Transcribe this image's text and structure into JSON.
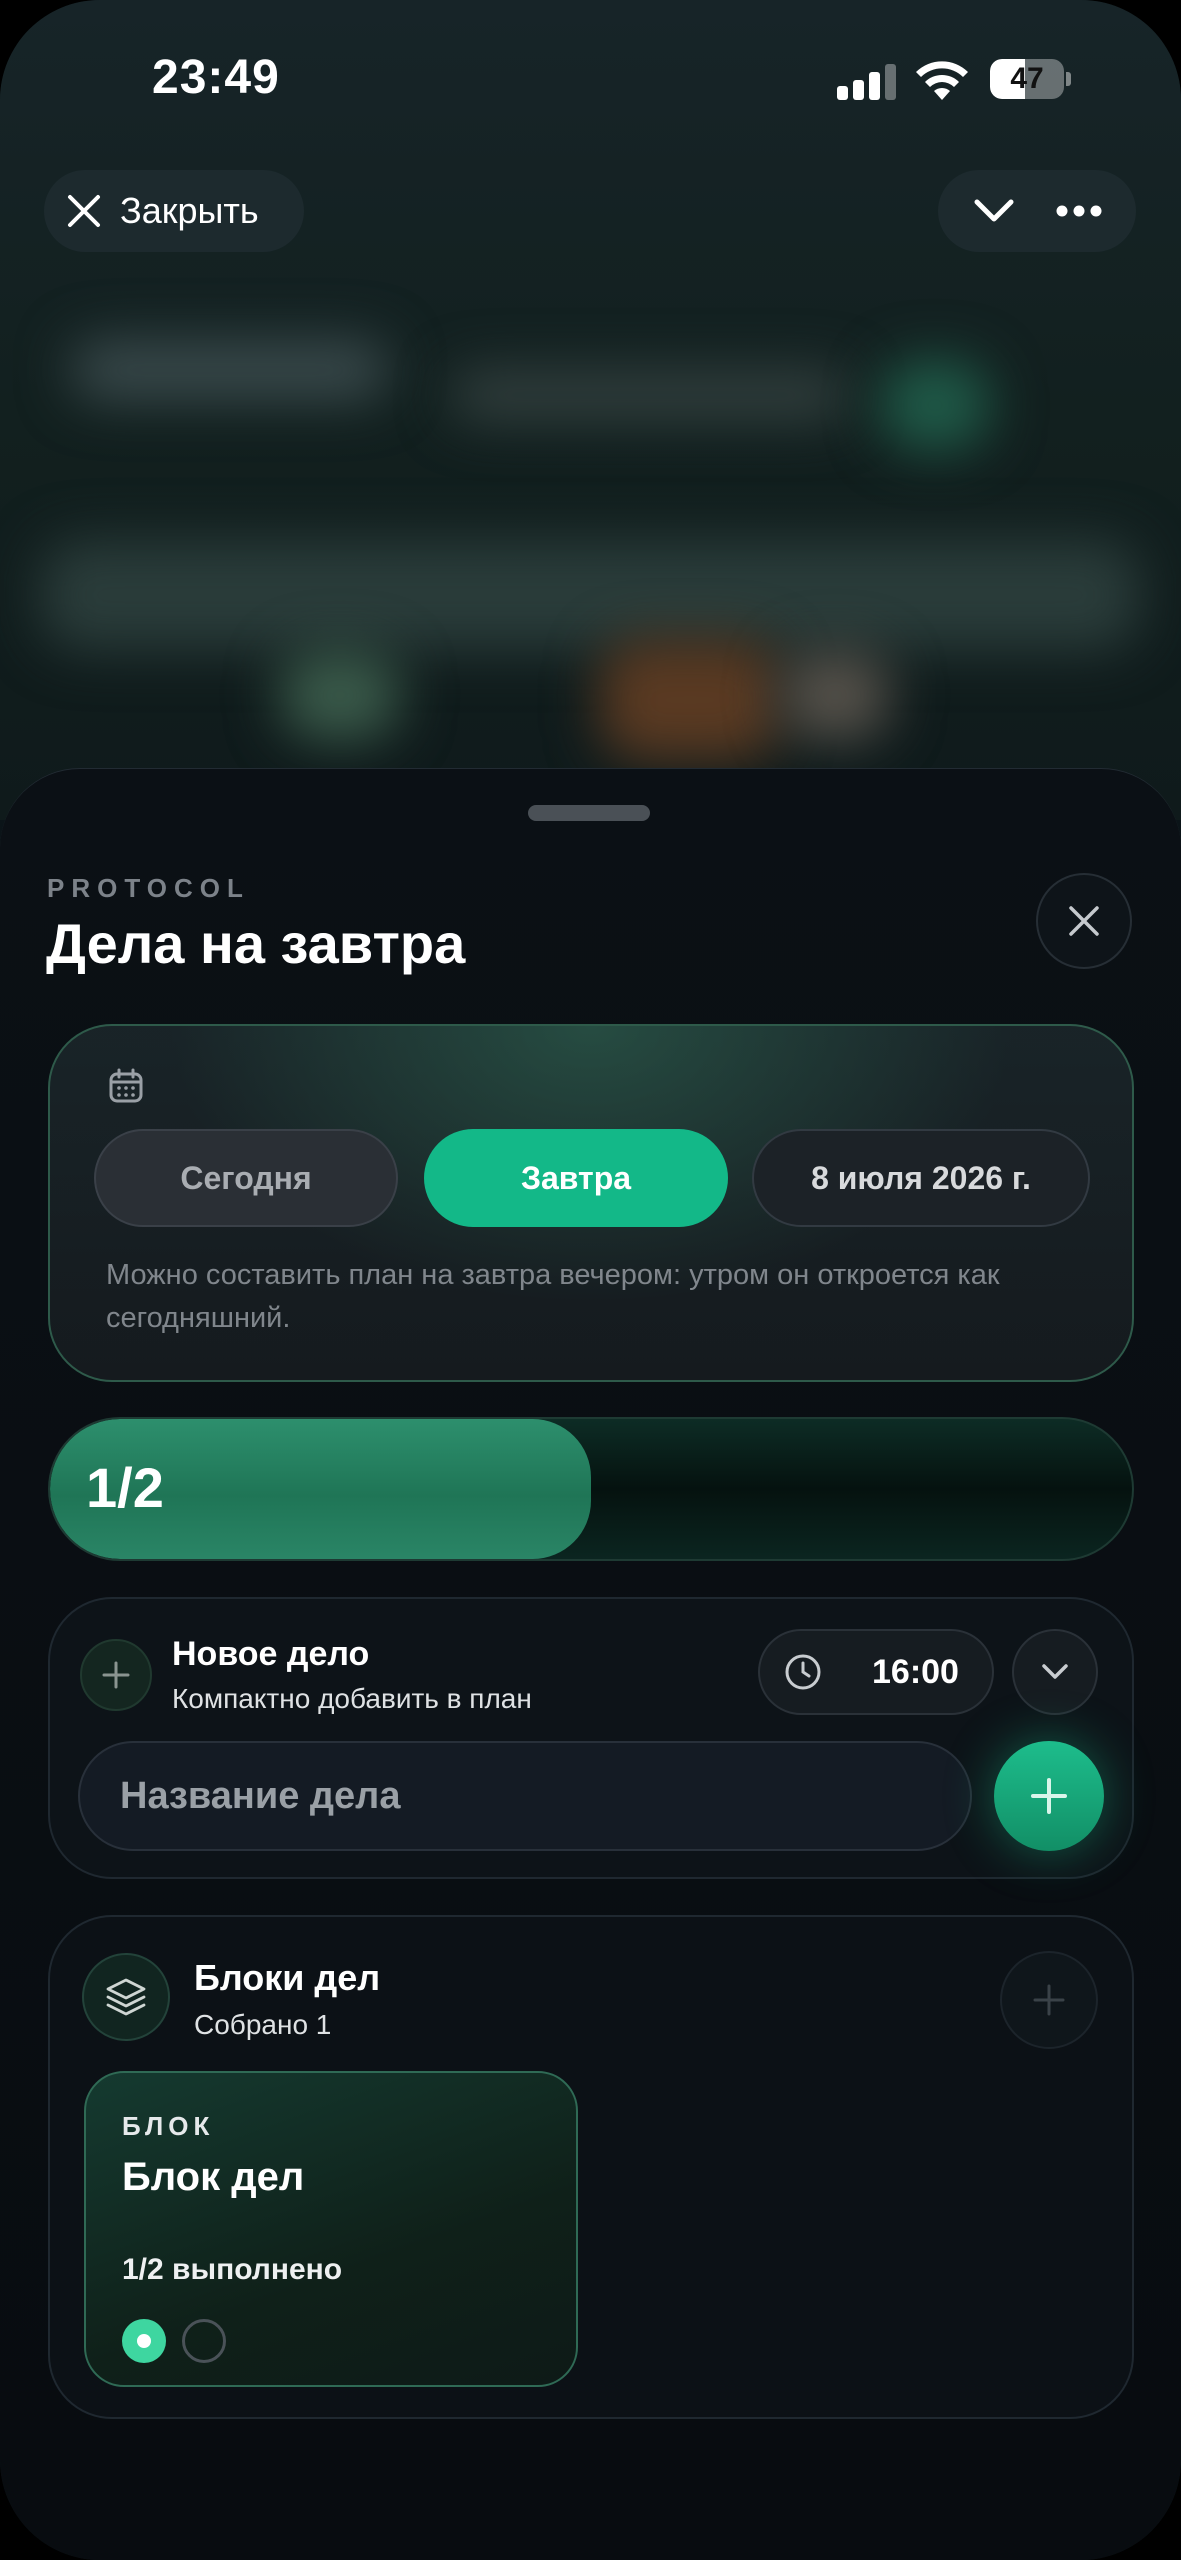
{
  "status_bar": {
    "time": "23:49",
    "battery": "47",
    "battery_level": 0.47
  },
  "top_bar": {
    "close_label": "Закрыть",
    "icons": [
      "close-icon",
      "chevron-down-icon",
      "more-icon"
    ]
  },
  "sheet": {
    "eyebrow": "PROTOCOL",
    "title": "Дела на завтра"
  },
  "date_picker": {
    "segments": [
      {
        "label": "Сегодня",
        "selected": false
      },
      {
        "label": "Завтра",
        "selected": true
      },
      {
        "label": "8 июля 2026 г.",
        "selected": false
      }
    ],
    "hint": "Можно составить план на завтра вечером: утром он откроется как сегодняшний."
  },
  "progress": {
    "label": "1/2",
    "done": 1,
    "total": 2
  },
  "new_task": {
    "title": "Новое дело",
    "subtitle": "Компактно добавить в план",
    "time": "16:00",
    "input_placeholder": "Название дела"
  },
  "blocks": {
    "title": "Блоки дел",
    "subtitle": "Собрано 1",
    "items": [
      {
        "eyebrow": "БЛОК",
        "title": "Блок дел",
        "progress_text": "1/2 выполнено",
        "steps": [
          true,
          false
        ]
      }
    ]
  },
  "colors": {
    "accent": "#13b888",
    "background": "#080c10"
  }
}
